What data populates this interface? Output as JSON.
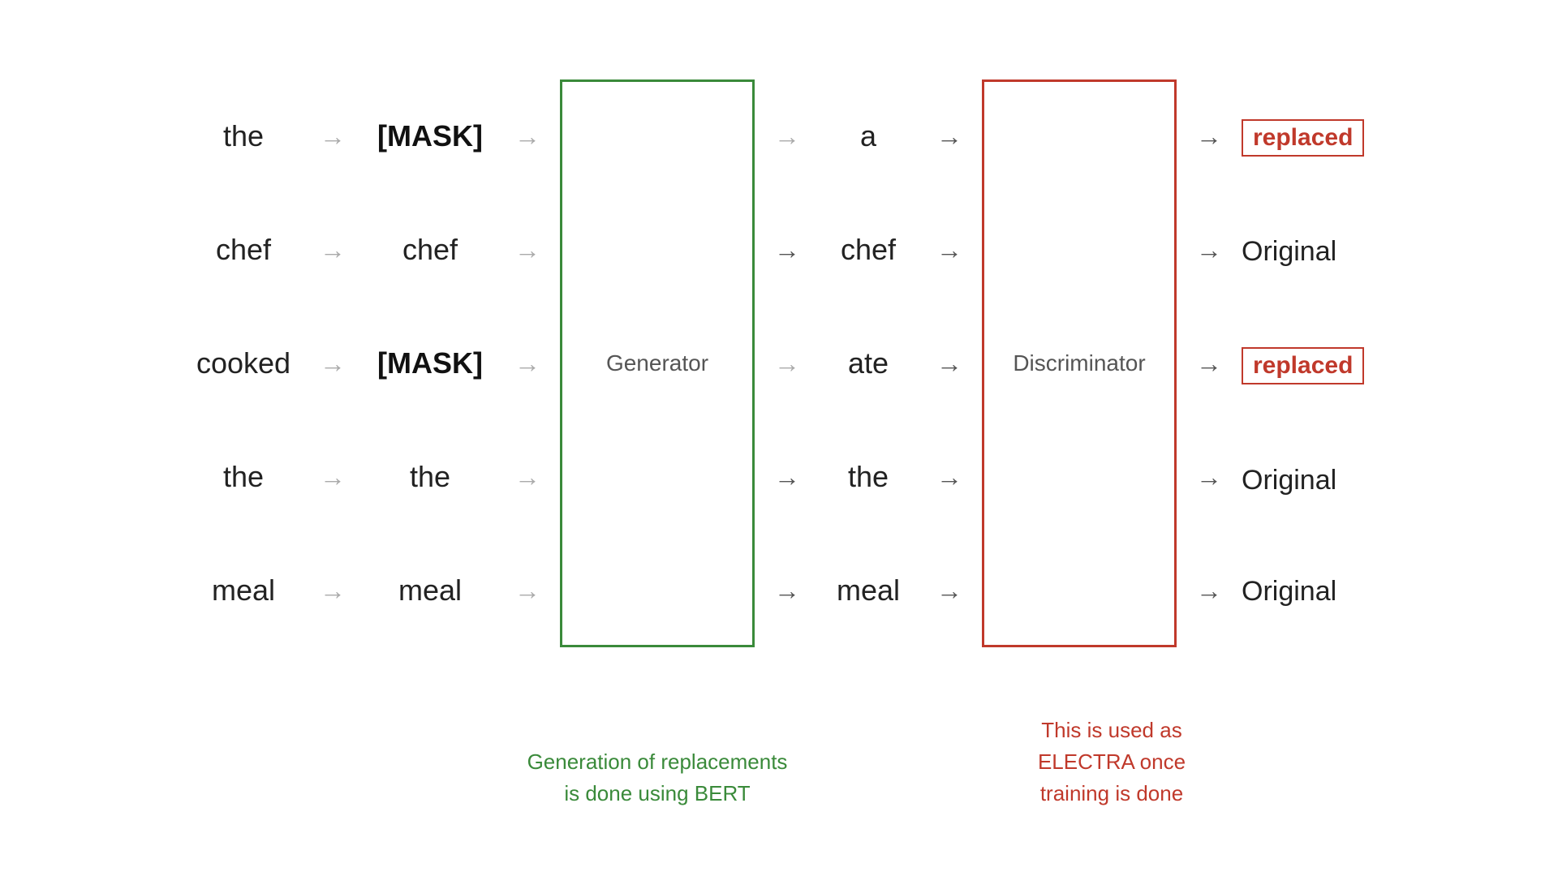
{
  "input_words": [
    "the",
    "chef",
    "cooked",
    "the",
    "meal"
  ],
  "masked_words": [
    "[MASK]",
    "chef",
    "[MASK]",
    "the",
    "meal"
  ],
  "output_words": [
    "a",
    "chef",
    "ate",
    "the",
    "meal"
  ],
  "result_labels": [
    "replaced",
    "Original",
    "replaced",
    "Original",
    "Original"
  ],
  "generator_label": "Generator",
  "discriminator_label": "Discriminator",
  "caption_generator": "Generation of replacements\nis done using BERT",
  "caption_discriminator": "This is used as\nELECTRA once\ntraining is done",
  "arrows": "→",
  "colors": {
    "generator_border": "#3a8a3a",
    "discriminator_border": "#c0392b",
    "replaced_color": "#c0392b",
    "arrow_light": "#aaaaaa",
    "arrow_dark": "#555555"
  }
}
